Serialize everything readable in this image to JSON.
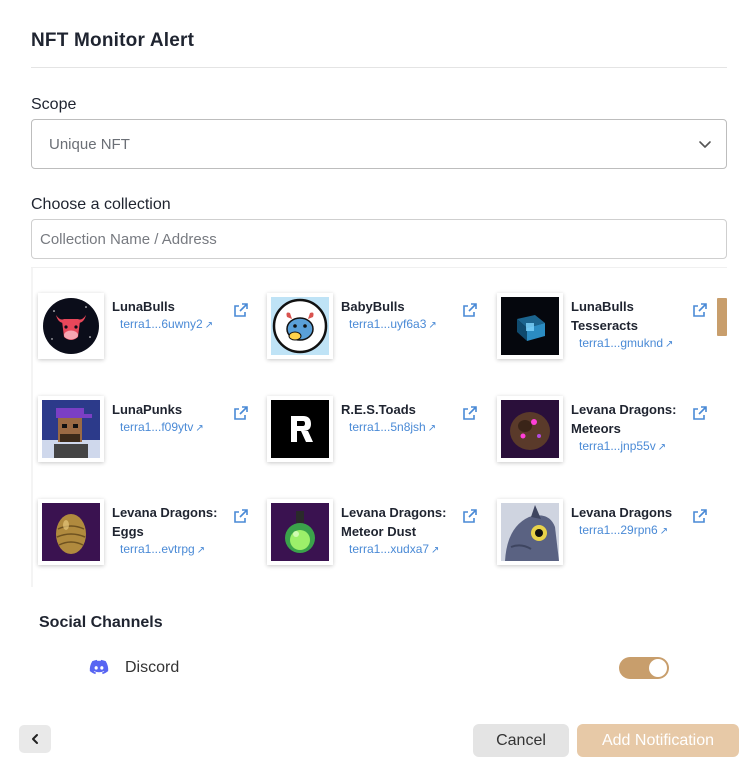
{
  "header": {
    "title": "NFT Monitor Alert"
  },
  "scope": {
    "label": "Scope",
    "selected": "Unique NFT"
  },
  "collection": {
    "label": "Choose a collection",
    "search_placeholder": "Collection Name / Address",
    "items": [
      {
        "name": "LunaBulls",
        "address": "terra1...6uwny2",
        "icon": "red-bull-logo"
      },
      {
        "name": "BabyBulls",
        "address": "terra1...uyf6a3",
        "icon": "blue-baby-bull-logo"
      },
      {
        "name": "LunaBulls Tesseracts",
        "address": "terra1...gmuknd",
        "icon": "glowing-tesseract-cube"
      },
      {
        "name": "LunaPunks",
        "address": "terra1...f09ytv",
        "icon": "pixel-punk-avatar"
      },
      {
        "name": "R.E.S.Toads",
        "address": "terra1...5n8jsh",
        "icon": "r-letter-logo"
      },
      {
        "name": "Levana Dragons: Meteors",
        "address": "terra1...jnp55v",
        "icon": "purple-meteor-rock"
      },
      {
        "name": "Levana Dragons: Eggs",
        "address": "terra1...evtrpg",
        "icon": "gold-dragon-egg"
      },
      {
        "name": "Levana Dragons: Meteor Dust",
        "address": "terra1...xudxa7",
        "icon": "green-dust-potion"
      },
      {
        "name": "Levana Dragons",
        "address": "terra1...29rpn6",
        "icon": "dragon-eye-portrait"
      }
    ]
  },
  "social": {
    "title": "Social Channels",
    "discord_label": "Discord",
    "discord_enabled": true
  },
  "footer": {
    "cancel_label": "Cancel",
    "add_label": "Add Notification"
  },
  "colors": {
    "accent": "#c89e6c",
    "accent_light": "#e7c9a7",
    "link": "#4a8ad6",
    "discord": "#5865f2"
  }
}
